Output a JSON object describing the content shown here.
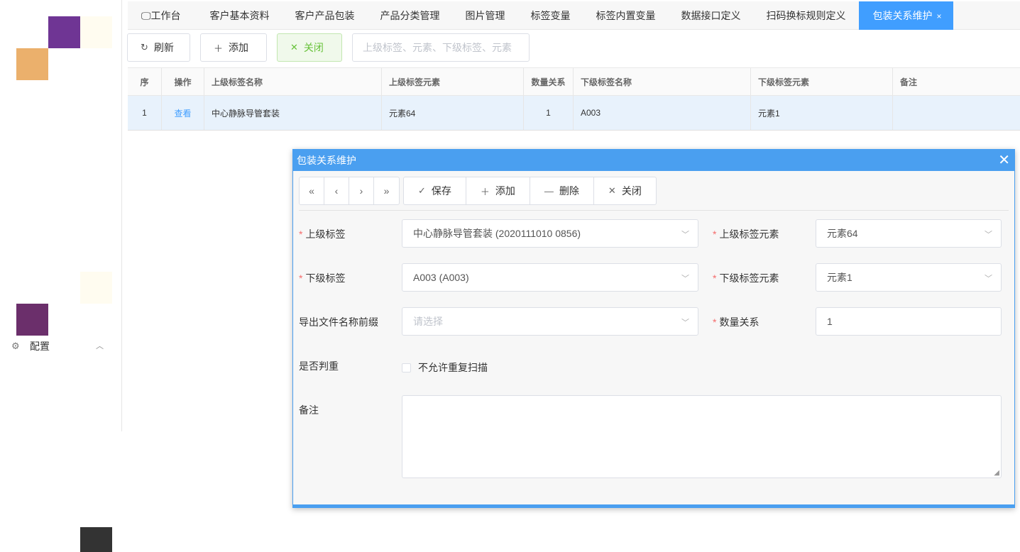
{
  "sidebar": {
    "config_label": "配置"
  },
  "tabs": [
    {
      "label": "工作台"
    },
    {
      "label": "客户基本资料"
    },
    {
      "label": "客户产品包装"
    },
    {
      "label": "产品分类管理"
    },
    {
      "label": "图片管理"
    },
    {
      "label": "标签变量"
    },
    {
      "label": "标签内置变量"
    },
    {
      "label": "数据接口定义"
    },
    {
      "label": "扫码换标规则定义"
    },
    {
      "label": "包装关系维护",
      "active": true
    }
  ],
  "toolbar": {
    "refresh": "刷新",
    "add": "添加",
    "close": "关闭",
    "search_placeholder": "上级标签、元素、下级标签、元素"
  },
  "table": {
    "headers": [
      "序",
      "操作",
      "上级标签名称",
      "上级标签元素",
      "数量关系",
      "下级标签名称",
      "下级标签元素",
      "备注"
    ],
    "rows": [
      {
        "seq": "1",
        "action": "查看",
        "parent_name": "中心静脉导管套装",
        "parent_element": "元素64",
        "qty": "1",
        "child_name": "A003",
        "child_element": "元素1",
        "remark": ""
      }
    ]
  },
  "dialog": {
    "title": "包装关系维护",
    "buttons": {
      "save": "保存",
      "add": "添加",
      "delete": "删除",
      "close": "关闭"
    },
    "fields": {
      "parent_tag_label": "上级标签",
      "parent_tag_value": "中心静脉导管套装 (2020111010 0856)",
      "parent_element_label": "上级标签元素",
      "parent_element_value": "元素64",
      "child_tag_label": "下级标签",
      "child_tag_value": "A003 (A003)",
      "child_element_label": "下级标签元素",
      "child_element_value": "元素1",
      "prefix_label": "导出文件名称前缀",
      "prefix_placeholder": "请选择",
      "qty_label": "数量关系",
      "qty_value": "1",
      "dup_label": "是否判重",
      "dup_checkbox_label": "不允许重复扫描",
      "remark_label": "备注"
    }
  },
  "colors": {
    "accent": "#409eff",
    "dialog_header": "#4a9ff0",
    "success": "#67c23a",
    "required": "#f56c6c"
  }
}
